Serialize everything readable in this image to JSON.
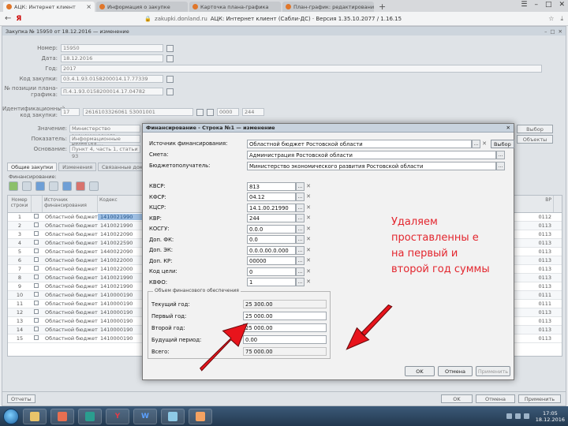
{
  "browser": {
    "tabs": [
      {
        "label": "АЦК: Интернет клиент",
        "active": true
      },
      {
        "label": "Информация о закупке",
        "active": false
      },
      {
        "label": "Карточка плана-графика",
        "active": false
      },
      {
        "label": "План-график: редактирование",
        "active": false
      }
    ],
    "new_tab": "+",
    "logo": "Я",
    "address_host": "zakupki.donland.ru",
    "address_title": "АЦК: Интернет клиент (Сабли-ДС) · Версия 1.35.10.2077 / 1.16.15"
  },
  "app": {
    "title": "Закупка № 15950 от 18.12.2016 — изменение",
    "fields": {
      "number_label": "Номер:",
      "number_value": "15950",
      "date_label": "Дата:",
      "date_value": "18.12.2016",
      "year_label": "Год:",
      "year_value": "2017",
      "purchase_code_label": "Код закупки:",
      "purchase_code_value": "03.4.1.93.0158200014.17.77339",
      "plan_position_label": "№ позиции плана-графика:",
      "plan_position_value": "П.4.1.93.0158200014.17.04782",
      "ident_label": "Идентификационный код закупки:",
      "ident_prefix": "17",
      "ident_value": "2616103326061 53001001",
      "ident_tail1": "0000",
      "ident_tail2": "244"
    },
    "side_labels": [
      "Значение:",
      "Показатель:",
      "Основание:"
    ],
    "side_values": [
      "Министерство экономического развития",
      "Информационные технологии",
      "Пункт 4, часть 1, статьи 93"
    ],
    "side_buttons": [
      "Выбор",
      "Объекты"
    ],
    "tabs": [
      "Общие закупки",
      "Изменения",
      "Связанные документы"
    ],
    "tabs_active": 0,
    "section_title": "Финансирование:",
    "grid_header": [
      "Номер строки",
      "",
      "Источник финансирования",
      "Кодекс",
      "",
      "ВР"
    ],
    "grid_rows": [
      {
        "n": "1",
        "src": "Областной бюджет",
        "code": "1410021990",
        "vr": "0112",
        "hl": true
      },
      {
        "n": "2",
        "src": "Областной бюджет",
        "code": "1410021990",
        "vr": "0113",
        "hl": false
      },
      {
        "n": "3",
        "src": "Областной бюджет",
        "code": "1410022090",
        "vr": "0113",
        "hl": false
      },
      {
        "n": "4",
        "src": "Областной бюджет",
        "code": "1410022590",
        "vr": "0113",
        "hl": false
      },
      {
        "n": "5",
        "src": "Областной бюджет",
        "code": "1440022090",
        "vr": "0113",
        "hl": false
      },
      {
        "n": "6",
        "src": "Областной бюджет",
        "code": "1410022000",
        "vr": "0113",
        "hl": false
      },
      {
        "n": "7",
        "src": "Областной бюджет",
        "code": "1410022000",
        "vr": "0113",
        "hl": false
      },
      {
        "n": "8",
        "src": "Областной бюджет",
        "code": "1410021990",
        "vr": "0113",
        "hl": false
      },
      {
        "n": "9",
        "src": "Областной бюджет",
        "code": "1410021990",
        "vr": "0113",
        "hl": false
      },
      {
        "n": "10",
        "src": "Областной бюджет",
        "code": "1410000190",
        "vr": "0111",
        "hl": false
      },
      {
        "n": "11",
        "src": "Областной бюджет",
        "code": "1410000190",
        "vr": "0111",
        "hl": false
      },
      {
        "n": "12",
        "src": "Областной бюджет",
        "code": "1410000190",
        "vr": "0113",
        "hl": false
      },
      {
        "n": "13",
        "src": "Областной бюджет",
        "code": "1410000190",
        "vr": "0113",
        "hl": false
      },
      {
        "n": "14",
        "src": "Областной бюджет",
        "code": "1410000190",
        "vr": "0113",
        "hl": false
      },
      {
        "n": "15",
        "src": "Областной бюджет",
        "code": "1410000190",
        "vr": "0113",
        "hl": false
      }
    ],
    "footer_left": "Отчеты",
    "footer_buttons": [
      "OK",
      "Отмена",
      "Применить"
    ]
  },
  "modal": {
    "title": "Финансирование - Строка №1 — изменение",
    "source_label": "Источник финансирования:",
    "source_value": "Областной бюджет Ростовской области",
    "choose_label": "Выбор",
    "estimate_label": "Смета:",
    "estimate_value": "Администрация Ростовской области",
    "recipient_label": "Бюджетополучатель:",
    "recipient_value": "Министерство экономического развития Ростовской области",
    "codes": [
      {
        "label": "КВСР:",
        "value": "813"
      },
      {
        "label": "КФСР:",
        "value": "04.12"
      },
      {
        "label": "КЦСР:",
        "value": "14.1.00.21990"
      },
      {
        "label": "КВР:",
        "value": "244"
      },
      {
        "label": "КОСГУ:",
        "value": "0.0.0"
      },
      {
        "label": "Доп. ФК:",
        "value": "0.0"
      },
      {
        "label": "Доп. ЭК:",
        "value": "0.0.0.00.0.000"
      },
      {
        "label": "Доп. КР:",
        "value": "00000"
      },
      {
        "label": "Код цели:",
        "value": "0"
      },
      {
        "label": "КВФО:",
        "value": "1"
      }
    ],
    "fieldset_legend": "Объем финансового обеспечения",
    "amounts": [
      {
        "label": "Текущий год:",
        "value": "25 300.00",
        "ro": true
      },
      {
        "label": "Первый год:",
        "value": "25 000.00",
        "ro": false
      },
      {
        "label": "Второй год:",
        "value": "25 000.00",
        "ro": false
      },
      {
        "label": "Будущий период:",
        "value": "0.00",
        "ro": false
      },
      {
        "label": "Всего:",
        "value": "75 000.00",
        "ro": true
      }
    ],
    "buttons": {
      "ok": "OK",
      "cancel": "Отмена",
      "apply": "Применить"
    }
  },
  "annotation": {
    "text": "Удаляем проставленны е на первый и второй год суммы",
    "color": "#e3262e"
  },
  "taskbar": {
    "apps": [
      "",
      "",
      "",
      "Y",
      "W",
      "",
      ""
    ],
    "time": "17:05",
    "date": "18.12.2016"
  }
}
